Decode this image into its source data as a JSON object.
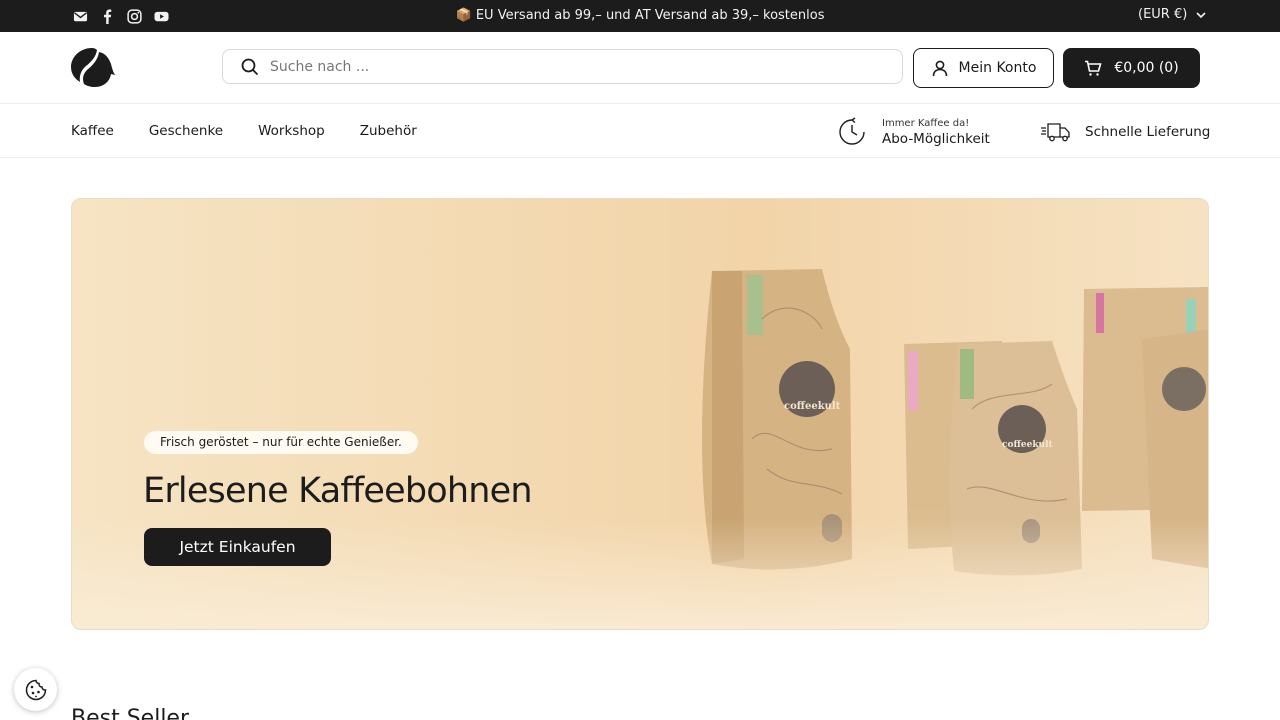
{
  "topbar": {
    "social_icons": [
      "email-icon",
      "facebook-icon",
      "instagram-icon",
      "youtube-icon"
    ],
    "announcement": "📦 EU Versand ab 99,– und AT Versand ab 39,– kostenlos",
    "currency": "(EUR €)"
  },
  "header": {
    "search_placeholder": "Suche nach ...",
    "search_value": "",
    "account_label": "Mein Konto",
    "cart_label": "€0,00 (0)"
  },
  "nav": {
    "items": [
      "Kaffee",
      "Geschenke",
      "Workshop",
      "Zubehör"
    ]
  },
  "usps": {
    "subscription_small": "Immer Kaffee da!",
    "subscription_big": "Abo-Möglichkeit",
    "delivery": "Schnelle Lieferung"
  },
  "hero": {
    "tag": "Frisch geröstet – nur für echte Genießer.",
    "title": "Erlesene Kaffeebohnen",
    "button": "Jetzt Einkaufen"
  },
  "sections": {
    "bestseller_title": "Best Seller"
  },
  "colors": {
    "dark": "#1c1c1c",
    "hero_bg": "#f3d9b1",
    "bag_kraft": "#d7b68a"
  }
}
